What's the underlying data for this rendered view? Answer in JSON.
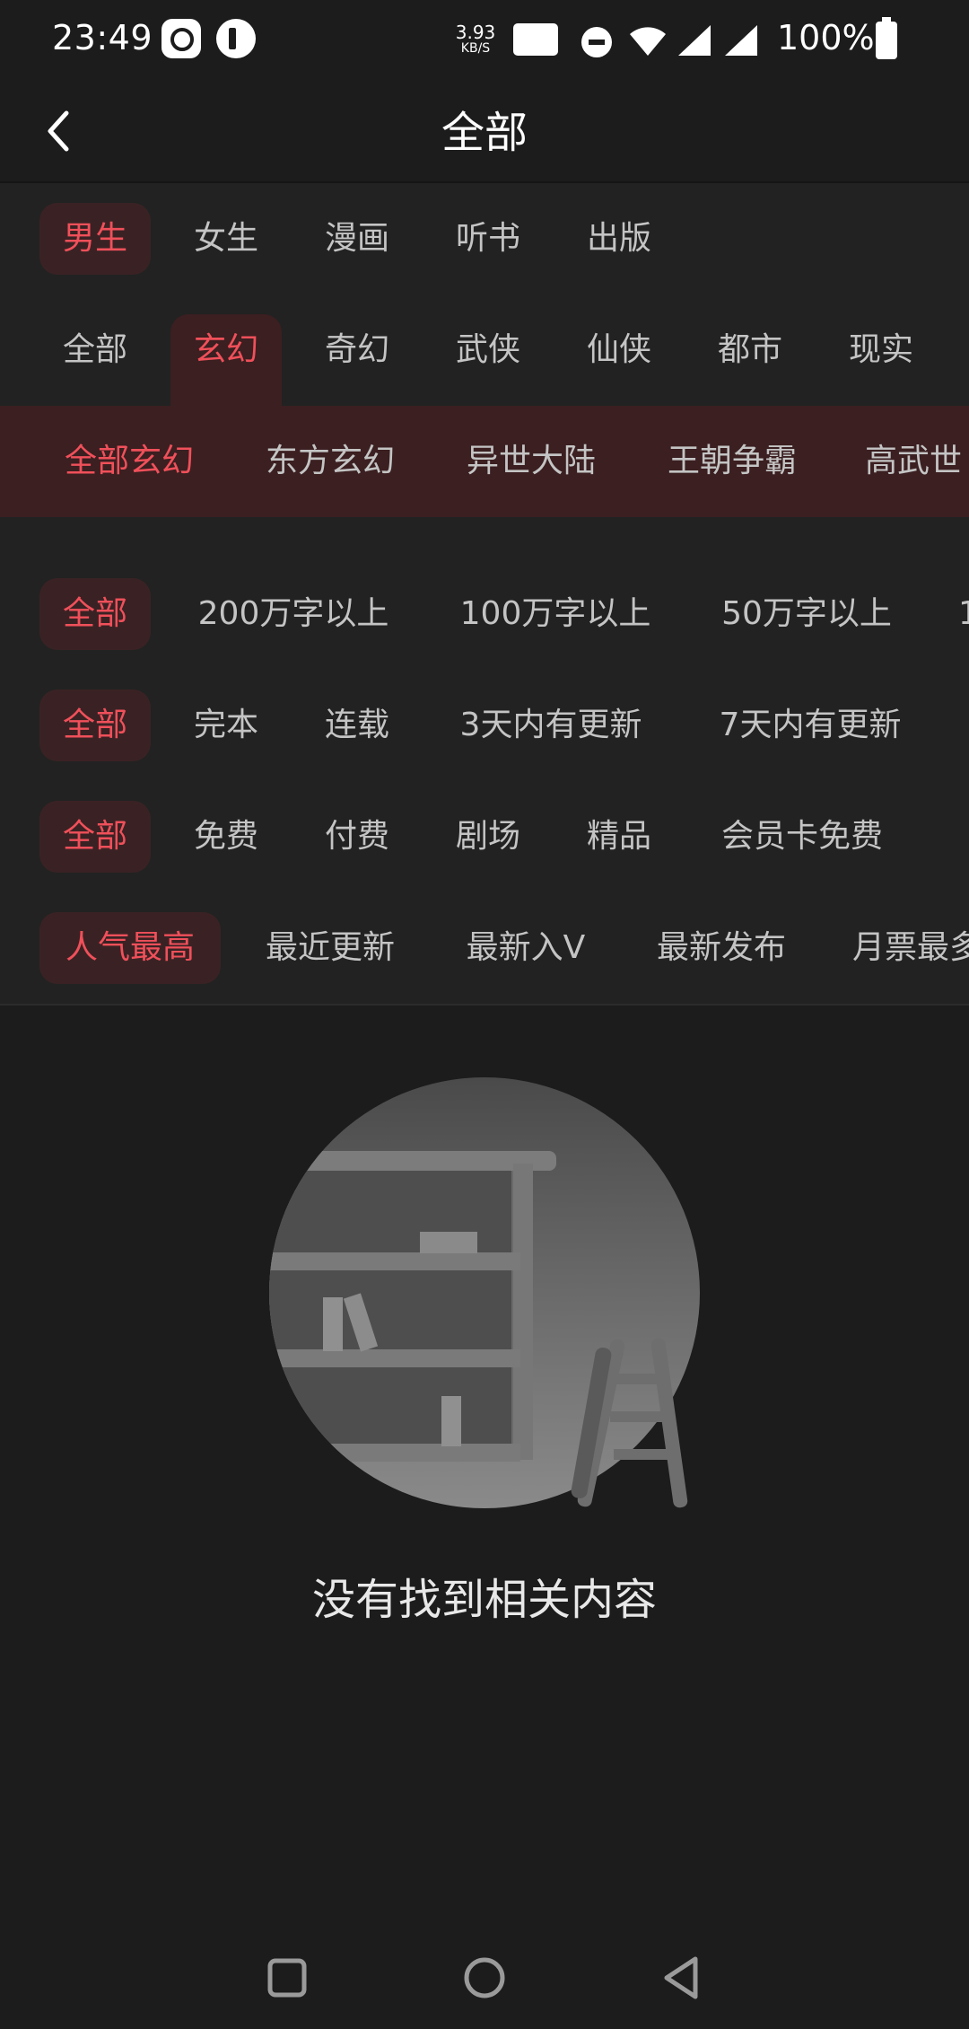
{
  "status_bar": {
    "time": "23:49",
    "net_speed_value": "3.93",
    "net_speed_unit": "KB/S",
    "battery": "100%"
  },
  "header": {
    "title": "全部"
  },
  "tabs": [
    {
      "label": "男生"
    },
    {
      "label": "女生"
    },
    {
      "label": "漫画"
    },
    {
      "label": "听书"
    },
    {
      "label": "出版"
    }
  ],
  "categories": [
    {
      "label": "全部"
    },
    {
      "label": "玄幻"
    },
    {
      "label": "奇幻"
    },
    {
      "label": "武侠"
    },
    {
      "label": "仙侠"
    },
    {
      "label": "都市"
    },
    {
      "label": "现实"
    }
  ],
  "subcategories": [
    {
      "label": "全部玄幻"
    },
    {
      "label": "东方玄幻"
    },
    {
      "label": "异世大陆"
    },
    {
      "label": "王朝争霸"
    },
    {
      "label": "高武世"
    }
  ],
  "word_count": [
    {
      "label": "全部"
    },
    {
      "label": "200万字以上"
    },
    {
      "label": "100万字以上"
    },
    {
      "label": "50万字以上"
    },
    {
      "label": "1"
    }
  ],
  "status_filter": [
    {
      "label": "全部"
    },
    {
      "label": "完本"
    },
    {
      "label": "连载"
    },
    {
      "label": "3天内有更新"
    },
    {
      "label": "7天内有更新"
    }
  ],
  "price_filter": [
    {
      "label": "全部"
    },
    {
      "label": "免费"
    },
    {
      "label": "付费"
    },
    {
      "label": "剧场"
    },
    {
      "label": "精品"
    },
    {
      "label": "会员卡免费"
    }
  ],
  "sort": [
    {
      "label": "人气最高"
    },
    {
      "label": "最近更新"
    },
    {
      "label": "最新入V"
    },
    {
      "label": "最新发布"
    },
    {
      "label": "月票最多"
    }
  ],
  "empty_state": {
    "message": "没有找到相关内容"
  },
  "colors": {
    "accent": "#f0505a",
    "selected_bg": "#3a2224",
    "background": "#1c1c1c"
  }
}
